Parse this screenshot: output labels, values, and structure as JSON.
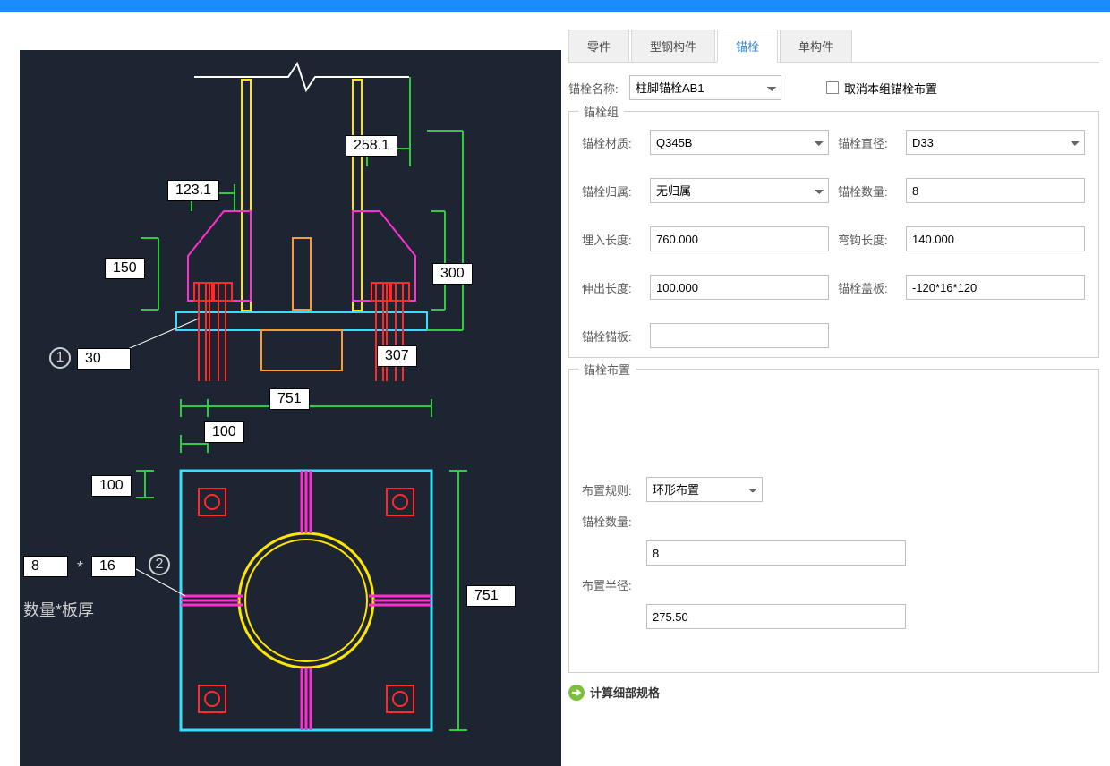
{
  "tabs": {
    "t0": "零件",
    "t1": "型钢构件",
    "t2": "锚栓",
    "t3": "单构件"
  },
  "name_row": {
    "label": "锚栓名称:",
    "value": "柱脚锚栓AB1",
    "cancel_label": "取消本组锚栓布置"
  },
  "group": {
    "title": "锚栓组",
    "material_l": "锚栓材质:",
    "material_v": "Q345B",
    "dia_l": "锚栓直径:",
    "dia_v": "D33",
    "belong_l": "锚栓归属:",
    "belong_v": "无归属",
    "count_l": "锚栓数量:",
    "count_v": "8",
    "embed_l": "埋入长度:",
    "embed_v": "760.000",
    "hook_l": "弯钩长度:",
    "hook_v": "140.000",
    "extend_l": "伸出长度:",
    "extend_v": "100.000",
    "cover_l": "锚栓盖板:",
    "cover_v": "-120*16*120",
    "anchor_l": "锚栓锚板:",
    "anchor_v": ""
  },
  "layout": {
    "title": "锚栓布置",
    "rule_l": "布置规则:",
    "rule_v": "环形布置",
    "count_l": "锚栓数量:",
    "count_v": "8",
    "radius_l": "布置半径:",
    "radius_v": "275.50"
  },
  "footer": "计算细部规格",
  "cad": {
    "d30": "30",
    "d123": "123.1",
    "d258": "258.1",
    "d150": "150",
    "d300": "300",
    "d307": "307",
    "d751a": "751",
    "d100a": "100",
    "d100b": "100",
    "d751b": "751",
    "s8": "8",
    "star": "*",
    "s16": "16",
    "qty_thk": "数量*板厚",
    "c1": "1",
    "c2": "2"
  }
}
